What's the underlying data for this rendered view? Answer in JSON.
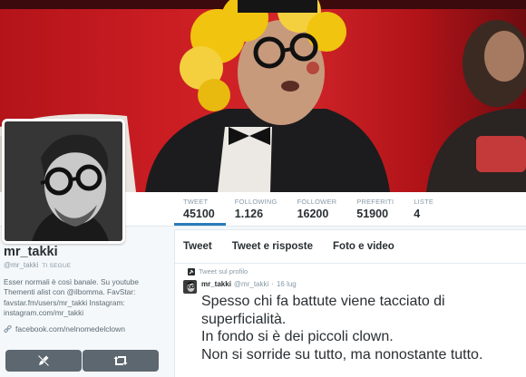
{
  "stats": [
    {
      "label": "TWEET",
      "value": "45100",
      "active": true
    },
    {
      "label": "FOLLOWING",
      "value": "1.126",
      "active": false
    },
    {
      "label": "FOLLOWER",
      "value": "16200",
      "active": false
    },
    {
      "label": "PREFERITI",
      "value": "51900",
      "active": false
    },
    {
      "label": "LISTE",
      "value": "4",
      "active": false
    }
  ],
  "profile": {
    "name": "mr_takki",
    "screen_name": "@mr_takki",
    "follows_you": "TI SEGUE",
    "bio_lines": [
      "Esser normali è così banale. Su youtube",
      "Thementi alist con @ilbomma. FavStar:",
      "favstar.fm/users/mr_takki Instagram:",
      "instagram.com/mr_takki"
    ],
    "link": "facebook.com/nelnomedelclown"
  },
  "tabs": [
    "Tweet",
    "Tweet e risposte",
    "Foto e video"
  ],
  "tweet": {
    "pinned_label": "Tweet sul profilo",
    "name": "mr_takki",
    "handle": "@mr_takki",
    "date": "16 lug",
    "lines": [
      "Spesso chi fa battute viene tacciato di",
      "superficialità.",
      "In fondo si è dei piccoli clown.",
      "Non si sorride su tutto, ma nonostante tutto."
    ]
  },
  "icons": {
    "pin": "pin-icon",
    "link": "link-icon",
    "compose": "compose-icon",
    "retweet": "retweet-icon"
  },
  "colors": {
    "banner_red": "#c91d22",
    "link_blue": "#2b7bb9",
    "button_gray": "#5c6770"
  }
}
